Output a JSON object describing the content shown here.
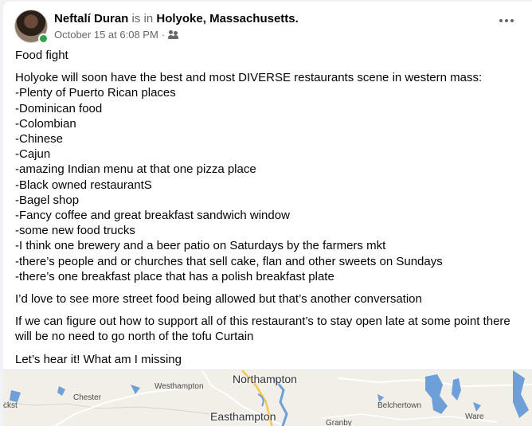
{
  "post": {
    "author": "Neftalí Duran",
    "is_in": "is in",
    "location": "Holyoke, Massachusetts.",
    "timestamp": "October 15 at 6:08 PM",
    "dot_sep": "·",
    "audience_icon": "friends-icon",
    "more_icon": "more-horizontal-icon",
    "paragraph_1": "Food fight",
    "intro": "Holyoke will soon have the best and most DIVERSE restaurants scene in western mass:",
    "list": [
      "-Plenty of Puerto Rican places",
      "-Dominican food",
      "-Colombian",
      "-Chinese",
      "-Cajun",
      "-amazing Indian menu at that one pizza place",
      "-Black owned restaurantS",
      "-Bagel shop",
      "-Fancy  coffee and great breakfast sandwich window",
      "-some new food trucks",
      "-I think one brewery and a beer patio on Saturdays by the farmers mkt",
      "-there’s people and or churches that sell cake, flan and other sweets on Sundays",
      "-there’s one breakfast place that has a polish breakfast plate"
    ],
    "paragraph_3": "I’d love to see more street food being allowed but that’s another conversation",
    "paragraph_4": "If we can figure out how to support all of this restaurant’s to stay open late at some point there will be no need to go north of the tofu Curtain",
    "paragraph_5": "Let’s hear it! What am I missing"
  },
  "map": {
    "labels": {
      "northampton": "Northampton",
      "westhampton": "Westhampton",
      "chester": "Chester",
      "easthampton": "Easthampton",
      "belchertown": "Belchertown",
      "granby": "Granby",
      "ware": "Ware",
      "edge_left": "ckst"
    },
    "colors": {
      "land": "#f1efe8",
      "water": "#6f9fd8",
      "road": "#f2c94c"
    }
  }
}
